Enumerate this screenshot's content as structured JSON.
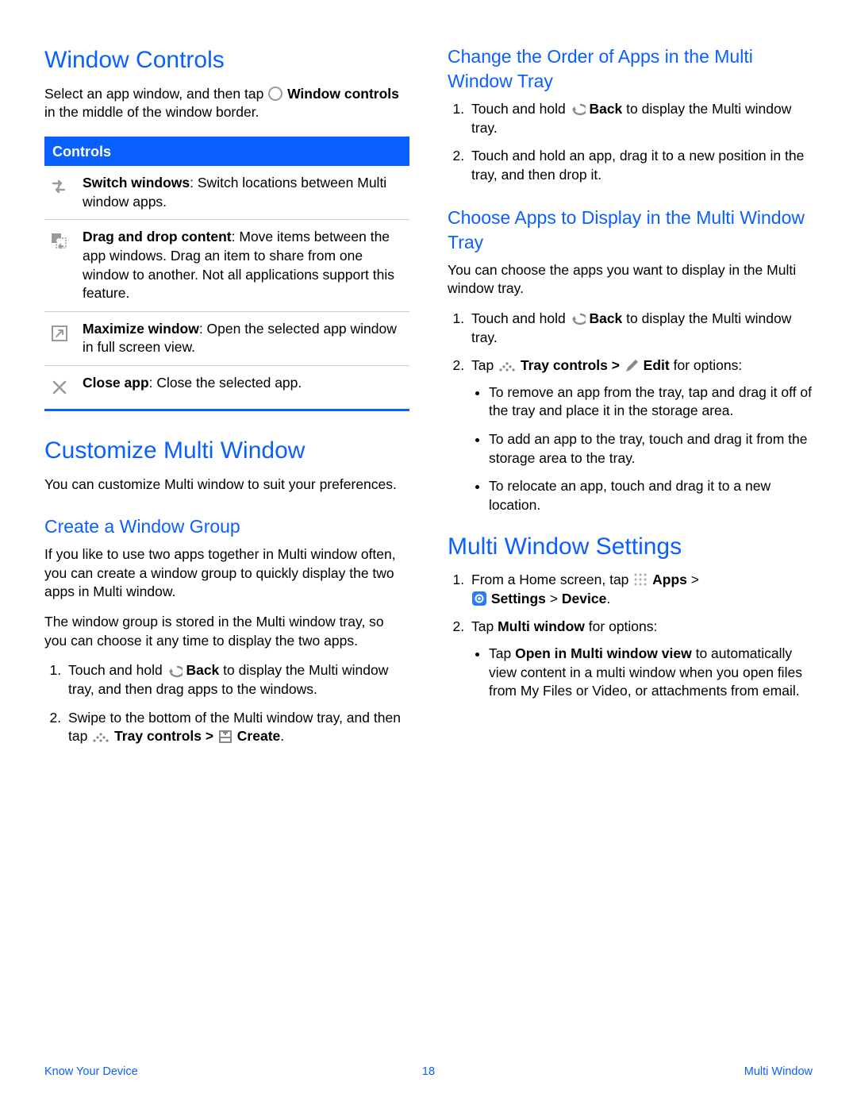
{
  "left": {
    "h1": "Window Controls",
    "intro_pre": "Select an app window, and then tap ",
    "intro_bold": "Window controls",
    "intro_post": " in the middle of the window border.",
    "controls_header": "Controls",
    "controls": [
      {
        "bold": "Switch windows",
        "rest": ": Switch locations between Multi window apps."
      },
      {
        "bold": "Drag and drop content",
        "rest": ": Move items between the app windows. Drag an item to share from one window to another. Not all applications support this feature."
      },
      {
        "bold": "Maximize window",
        "rest": ": Open the selected app window in full screen view."
      },
      {
        "bold": "Close app",
        "rest": ": Close the selected app."
      }
    ],
    "h1b": "Customize Multi Window",
    "customize_intro": "You can customize Multi window to suit your preferences.",
    "h2_create": "Create a Window Group",
    "create_p1": "If you like to use two apps together in Multi window often, you can create a window group to quickly display the two apps in Multi window.",
    "create_p2": "The window group is stored in the Multi window tray, so you can choose it any time to display the two apps.",
    "create_s1_a": "Touch and hold ",
    "create_s1_back": "Back",
    "create_s1_b": " to display the Multi window tray, and then drag apps to the windows.",
    "create_s2_a": "Swipe to the bottom of the Multi window tray, and then tap ",
    "create_s2_tray": "Tray controls > ",
    "create_s2_create": "Create",
    "create_s2_dot": "."
  },
  "right": {
    "h2_order": "Change the Order of Apps in the Multi Window Tray",
    "order_s1_a": "Touch and hold ",
    "order_s1_back": "Back",
    "order_s1_b": " to display the Multi window tray.",
    "order_s2": "Touch and hold an app, drag it to a new position in the tray, and then drop it.",
    "h2_choose": "Choose Apps to Display in the Multi Window Tray",
    "choose_intro": "You can choose the apps you want to display in the Multi window tray.",
    "choose_s1_a": "Touch and hold ",
    "choose_s1_back": "Back",
    "choose_s1_b": " to display the Multi window tray.",
    "choose_s2_a": "Tap ",
    "choose_s2_tray": "Tray controls > ",
    "choose_s2_edit": "Edit",
    "choose_s2_b": " for options:",
    "choose_b1": "To remove an app from the tray, tap and drag it off of the tray and place it in the storage area.",
    "choose_b2": "To add an app to the tray, touch and drag it from the storage area to the tray.",
    "choose_b3": "To relocate an app, touch and drag it to a new location.",
    "h1_settings": "Multi Window Settings",
    "set_s1_a": "From a Home screen, tap ",
    "set_s1_apps": "Apps",
    "set_s1_b": " > ",
    "set_s1_settings": "Settings",
    "set_s1_c": " > ",
    "set_s1_device": "Device",
    "set_s1_d": ".",
    "set_s2_a": "Tap ",
    "set_s2_mw": "Multi window",
    "set_s2_b": " for options:",
    "set_b1_a": "Tap ",
    "set_b1_open": "Open in Multi window view",
    "set_b1_b": " to automatically view content in a multi window when you open files from My Files or Video, or attachments from email."
  },
  "footer": {
    "left": "Know Your Device",
    "center": "18",
    "right": "Multi Window"
  }
}
